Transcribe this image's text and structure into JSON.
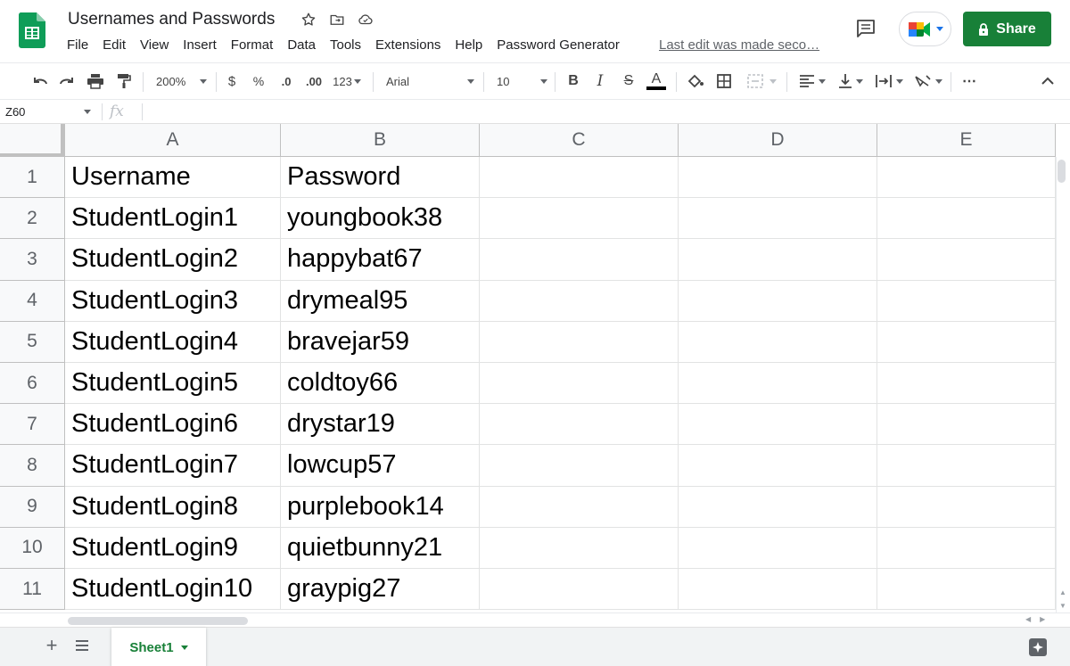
{
  "app": {
    "title": "Usernames and Passwords",
    "last_edit": "Last edit was made seco…",
    "share_label": "Share",
    "brand_color": "#0f9d58",
    "share_color": "#188038"
  },
  "menu": [
    "File",
    "Edit",
    "View",
    "Insert",
    "Format",
    "Data",
    "Tools",
    "Extensions",
    "Help",
    "Password Generator"
  ],
  "toolbar": {
    "zoom": "200%",
    "currency": "$",
    "percent": "%",
    "decrease_decimal": ".0",
    "increase_decimal": ".00",
    "more_formats": "123",
    "font": "Arial",
    "font_size": "10",
    "bold": "B",
    "italic": "I",
    "strikethrough": "S",
    "text_color": "A",
    "more": "⋯"
  },
  "formula_bar": {
    "name_box": "Z60",
    "fx": "fx",
    "value": ""
  },
  "columns": [
    "A",
    "B",
    "C",
    "D",
    "E"
  ],
  "rows": [
    {
      "num": "1",
      "a": "Username",
      "b": "Password"
    },
    {
      "num": "2",
      "a": "StudentLogin1",
      "b": "youngbook38"
    },
    {
      "num": "3",
      "a": "StudentLogin2",
      "b": "happybat67"
    },
    {
      "num": "4",
      "a": "StudentLogin3",
      "b": "drymeal95"
    },
    {
      "num": "5",
      "a": "StudentLogin4",
      "b": "bravejar59"
    },
    {
      "num": "6",
      "a": "StudentLogin5",
      "b": "coldtoy66"
    },
    {
      "num": "7",
      "a": "StudentLogin6",
      "b": "drystar19"
    },
    {
      "num": "8",
      "a": "StudentLogin7",
      "b": "lowcup57"
    },
    {
      "num": "9",
      "a": "StudentLogin8",
      "b": "purplebook14"
    },
    {
      "num": "10",
      "a": "StudentLogin9",
      "b": "quietbunny21"
    },
    {
      "num": "11",
      "a": "StudentLogin10",
      "b": "graypig27"
    }
  ],
  "sheets": [
    {
      "name": "Sheet1",
      "active": true
    }
  ],
  "icons": {
    "star": "star-icon",
    "move": "move-to-folder-icon",
    "cloud": "cloud-status-icon",
    "comments": "comments-icon",
    "meet": "google-meet-icon",
    "lock": "lock-icon",
    "explore": "explore-icon"
  }
}
